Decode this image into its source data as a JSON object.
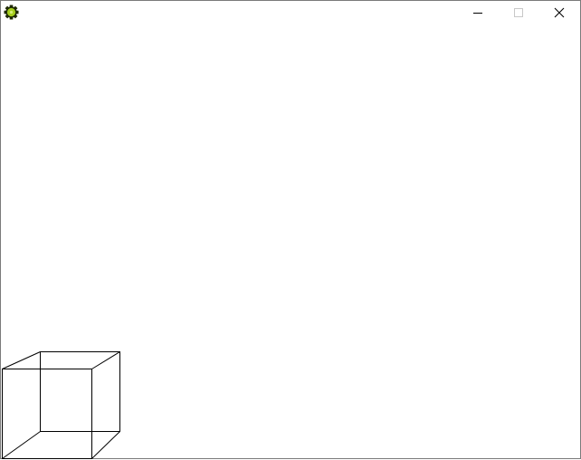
{
  "window": {
    "title": "",
    "controls": {
      "minimize_icon": "minimize-icon",
      "maximize_icon": "maximize-icon",
      "close_icon": "close-icon"
    }
  },
  "app_icon": {
    "name": "gear-icon",
    "colors": {
      "outer": "#1f2a05",
      "inner": "#a6cf1e"
    }
  },
  "canvas": {
    "background": "#ffffff",
    "shape": "wireframe-cube",
    "stroke_color": "#000000"
  }
}
